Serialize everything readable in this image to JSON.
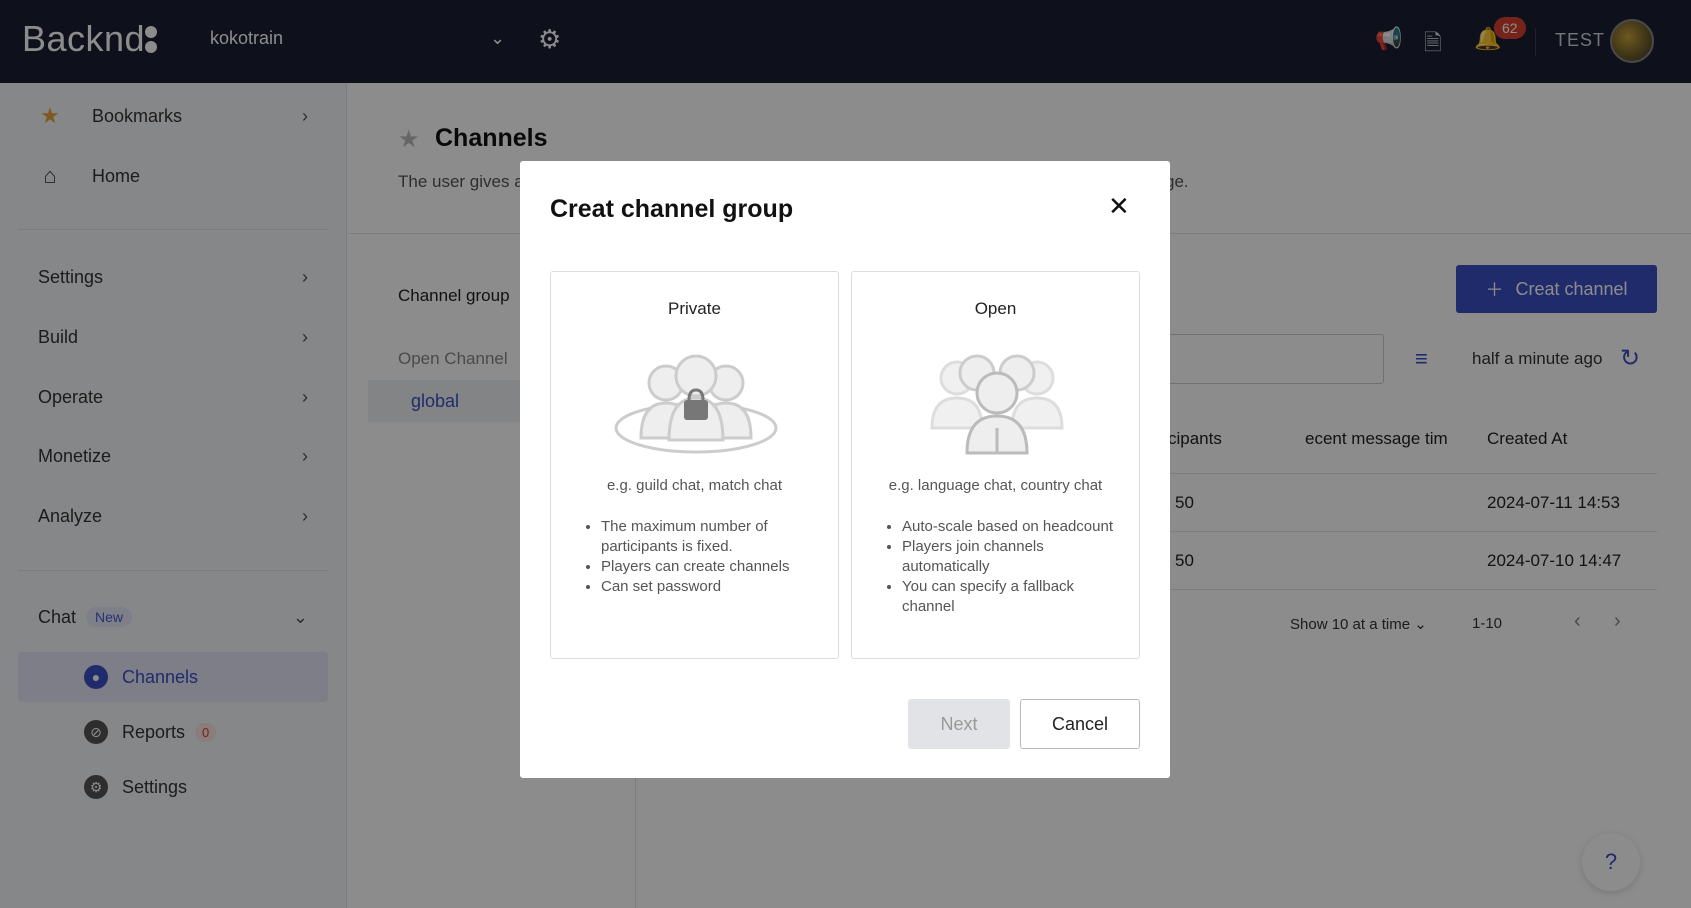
{
  "topbar": {
    "logo": "Backnd",
    "project": "kokotrain",
    "notification_count": "62",
    "user": "TEST"
  },
  "sidebar": {
    "bookmarks": "Bookmarks",
    "home": "Home",
    "settings": "Settings",
    "build": "Build",
    "operate": "Operate",
    "monetize": "Monetize",
    "analyze": "Analyze",
    "chat": "Chat",
    "chat_tag": "New",
    "channels": "Channels",
    "reports": "Reports",
    "reports_count": "0",
    "chat_settings": "Settings"
  },
  "page": {
    "title": "Channels",
    "description_start": "The user gives a",
    "description_end": "ge.",
    "channel_group_label": "Channel group",
    "open_channel": "Open Channel",
    "global": "global",
    "create_button": "Creat channel",
    "refresh_time": "half a minute ago",
    "columns": [
      "cipants",
      "ecent message tim",
      "Created At"
    ],
    "rows": [
      {
        "participants": "50",
        "created": "2024-07-11 14:53"
      },
      {
        "participants": "50",
        "created": "2024-07-10 14:47"
      }
    ],
    "page_size": "Show 10 at a time",
    "range": "1-10",
    "help": "?"
  },
  "modal": {
    "title": "Creat channel group",
    "options": [
      {
        "title": "Private",
        "example": "e.g. guild chat, match chat",
        "features": [
          "The maximum number of participants is fixed.",
          "Players can create channels",
          "Can set password"
        ]
      },
      {
        "title": "Open",
        "example": "e.g. language chat, country chat",
        "features": [
          "Auto-scale based on headcount",
          "Players join channels automatically",
          "You can specify a fallback channel"
        ]
      }
    ],
    "next_label": "Next",
    "cancel_label": "Cancel"
  },
  "colors": {
    "topbar": "#1a2034",
    "accent": "#3b4fc4",
    "badge": "#d8412f"
  }
}
